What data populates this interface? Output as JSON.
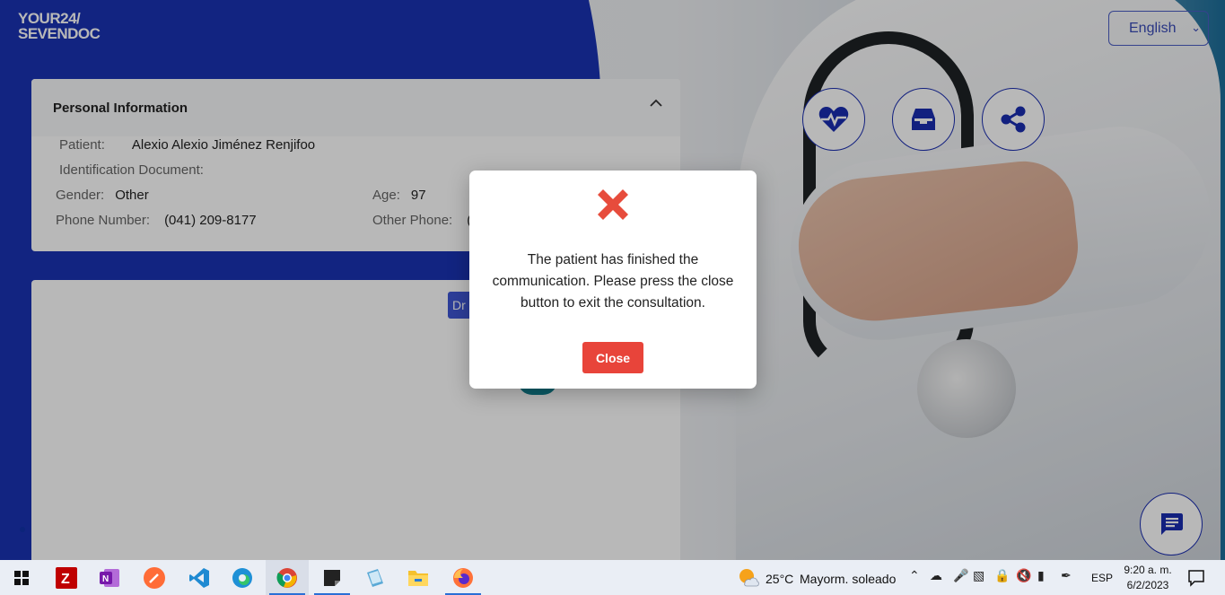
{
  "logo": {
    "line1": "YOUR24/",
    "line2": "SEVENDOC"
  },
  "language": {
    "selected": "English"
  },
  "action_buttons": [
    {
      "icon": "heart-pulse-icon"
    },
    {
      "icon": "inbox-icon"
    },
    {
      "icon": "share-icon"
    }
  ],
  "personal_info": {
    "title": "Personal Information",
    "patient_label": "Patient:",
    "patient_value": "Alexio Alexio Jiménez Renjifoo",
    "id_label": "Identification Document:",
    "id_value": "",
    "gender_label": "Gender:",
    "gender_value": "Other",
    "age_label": "Age:",
    "age_value": "97",
    "phone_label": "Phone Number:",
    "phone_value": "(041) 209-8177",
    "other_phone_label": "Other Phone:",
    "other_phone_value": "("
  },
  "video": {
    "doctor_chip": "Dr"
  },
  "modal": {
    "icon": "error-x-icon",
    "message": "The patient has finished the communication. Please press the close button to exit the consultation.",
    "close_label": "Close",
    "colors": {
      "icon": "#e74c3c",
      "button": "#e8443a"
    }
  },
  "colors": {
    "brand_blue": "#1a33b3"
  },
  "taskbar": {
    "apps": [
      "windows-start-icon",
      "filezilla-icon",
      "onenote-icon",
      "postman-icon",
      "vscode-icon",
      "edge-icon",
      "chrome-icon",
      "sticky-notes-icon",
      "notes-app-icon",
      "file-explorer-icon",
      "firefox-icon"
    ],
    "weather_temp": "25°C",
    "weather_text": "Mayorm. soleado",
    "language": "ESP",
    "time": "9:20 a. m.",
    "date": "6/2/2023"
  }
}
